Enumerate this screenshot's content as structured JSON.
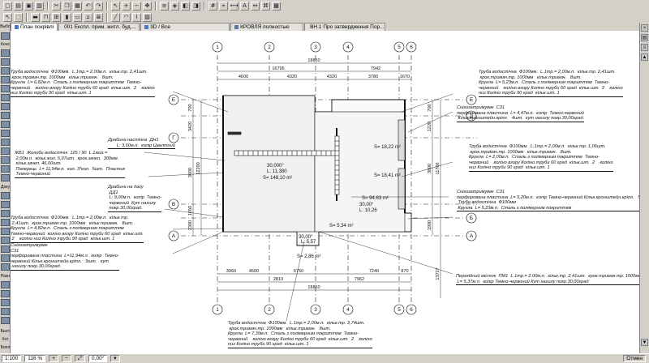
{
  "toolbar_icons": [
    "new-icon",
    "open-icon",
    "save-icon",
    "print-icon",
    "cut-icon",
    "copy-icon",
    "paste-icon",
    "undo-icon",
    "redo-icon",
    "pointer-icon",
    "zoom-in-icon",
    "zoom-out-icon",
    "pan-icon",
    "layers-icon",
    "3d-icon",
    "section-icon",
    "elevation-icon",
    "grid-icon",
    "snap-icon",
    "measure-icon",
    "text-icon",
    "dimension-icon",
    "label-icon",
    "fill-icon"
  ],
  "tabs": [
    {
      "label": "План покрівлі"
    },
    {
      "label": "001 Експл. прим. житл. буд...."
    },
    {
      "label": "3D / Все"
    },
    {
      "label": "КРОВЛЯ полностью"
    },
    {
      "label": "ВН.1 Про затвердження Пор..."
    }
  ],
  "toolbox": {
    "top_label": "Выбо",
    "labels": [
      "Конс",
      "Доку",
      "Разн"
    ],
    "bottom_labels": [
      "Быст",
      "Хот",
      "Болл"
    ]
  },
  "canvas": {
    "axes_letters": [
      "Е",
      "Д",
      "Г",
      "В",
      "Б",
      "А"
    ],
    "axes_numbers": [
      "1",
      "2",
      "3",
      "4",
      "5",
      "6"
    ],
    "dim_top": [
      "18860",
      "16795",
      "7942",
      "4600",
      "4320",
      "4320",
      "3780",
      "1670"
    ],
    "dim_bottom": [
      "3960",
      "4600",
      "6750",
      "7240",
      "870",
      "18860",
      "2810",
      "7962"
    ],
    "dim_left": [
      "700",
      "3420",
      "12200",
      "3600",
      "1050",
      "2300",
      "1600",
      "700"
    ],
    "dim_right": [
      "700",
      "1220",
      "11700",
      "3800",
      "1900",
      "13727"
    ],
    "areas": [
      {
        "label": "30,000°",
        "length": "L: 11,380",
        "area": "S= 148,10 m²"
      },
      {
        "label": "S= 18,22 m²",
        "length": "",
        "area": ""
      },
      {
        "label": "S= 18,41 m²",
        "length": "",
        "area": ""
      },
      {
        "label": "30,00°",
        "length": "L: 10,26",
        "area": "S= 94,63 m²"
      },
      {
        "label": "S= 5,34 m²",
        "length": "",
        "area": ""
      },
      {
        "label": "30,00°",
        "length": "L: 5,57",
        "area": ""
      },
      {
        "label": "S= 2,86 m²",
        "length": "",
        "area": ""
      }
    ],
    "notes": [
      {
        "id": "n1",
        "text": "Труба водостічна  Ф100мм.  L.1mp.= 2,00м.п.  кільк.тр. 2,41шт.\n крок.тримач.тр. 1000мм   кільк.тримач.   8шт.\nКругла  L= 6,82м.п.  Сталь з полімерним покриттям  Темно-\nчервоний    коліно вгору Коліно труби 60 град  кільк.шт.  2    коліно\nниз Коліно труби 90 град  кільк.шт. 1"
      },
      {
        "id": "n2",
        "text": "Драбина настінна  ДН1\n       L: 3,60м.п.  колір Цвалтний"
      },
      {
        "id": "n3",
        "text": "ЖБ1  Жолоби водостічні  125 / 90  L.1жол.=\n 2,00м.п.  кільк.жол. 5,97шт.  крок.зачеп.  300мм.\n кільк.зачеп. 46,00шт.\n Паперець  L= 11,94м.п.  кол. 3*кол.  5шт.  Пластик\n Темно-червоний"
      },
      {
        "id": "n4",
        "text": "Драбина на даху\n ДД1\n L: 9,00м.п.  колір  Темно-\n червоний  Кут нахилу\n покр.30,00град."
      },
      {
        "id": "n5",
        "text": "Труба водостічна  Ф100мм.  L.1mp.= 2,00м.п.  кільк.тр.\n 2,41шт.  крок.тримач.тр. 1000мм   кільк.тримач.   8шт.\nКругла  L= 4,82м.п.  Сталь з полімерним покриттям\nТемно-червоний  коліно вгору Коліно труби 60 град  кільк.шт.\n 2    коліно низ Коліно труби 90 град  кільк.шт. 1"
      },
      {
        "id": "n6",
        "text": "Снігозатримувач\nС31\nперфорована пластина  L=11,94м.п.  колір  Темно-\nчервоний Кільк.кронштейн.кріпл.   9шт.   кут\n нахилу покр.30,00град."
      },
      {
        "id": "n7",
        "text": "Труба водостічна  Ф100мм.  L.1mp.= 2,00м.п.  кільк.тр. 2,41шт.\n крок.тримач.тр. 1000мм   кільк.тримач.   8шт.\nКругла  L= 5,23м.п.  Сталь з полімерним покриттям  Темно-\nчервоний    коліно вгору Коліно труби 60 град  кільк.шт.  2    коліно\nниз Коліно труби 90 град  кільк.шт. 1"
      },
      {
        "id": "n8",
        "text": "Снігозатримувач  С31\nперфорована пластина  L= 4,47м.п.  колір  Темно-червоний\n Кільк.кронштейн.кріпл.   4шт.  кут нахилу покр.30,00град."
      },
      {
        "id": "n9",
        "text": "Труба водостічна  Ф100мм.  L.1mp.= 2,00м.п.  кільк.тр. 1,06шт.\n крок.тримач.тр. 1000мм   кільк.тримач.   8шт.\nКругла  L= 2,00м.п.  Сталь з полімерним покриттям  Темно-\nчервоний    коліно вгору Коліно труби 60 град  кільк.шт.  2    коліно\nниз Коліно труби 90 град  кільк.шт. 1"
      },
      {
        "id": "n10",
        "text": "Снігозатримувач  С31\nперфорована пластина  L= 5,20м.п.  колір Темно-червоний Кільк.кронштейн.кріпл.   5шт.\n Труба водостічна  Ф100мм\n Кругла  L= 5,23м.п.  Сталь з полімерним покриттям"
      },
      {
        "id": "n11",
        "text": "Перехідний місток  ПМ1  L.1mp.= 2,00м.п.  кільк.тр. 2,41шт.  крок.тримач.тр. 1000мм\n L= 5,37м.п.  колір Темно-червоний Кут нахилу покр.30,00град"
      },
      {
        "id": "n12",
        "text": "Труба водостічна  Ф100мм.  L.1mp.= 2,00м.п.  кільк.тр. 3,74шт.\n крок.тримач.тр. 1000мм   кільк.тримач.   8шт.\nКругла  L= 7,39м.п.  Сталь з полімерним покриттям  Темно-\nчервоний    коліно вгору Коліно труби 60 град  кільк.шт.  2    коліно\nниз Коліно труби 90 град  кільк.шт. 1"
      }
    ]
  },
  "status": {
    "scale": "1:100",
    "zoom": "116 %",
    "angle": "0,00°",
    "right_button": "Отмен"
  }
}
